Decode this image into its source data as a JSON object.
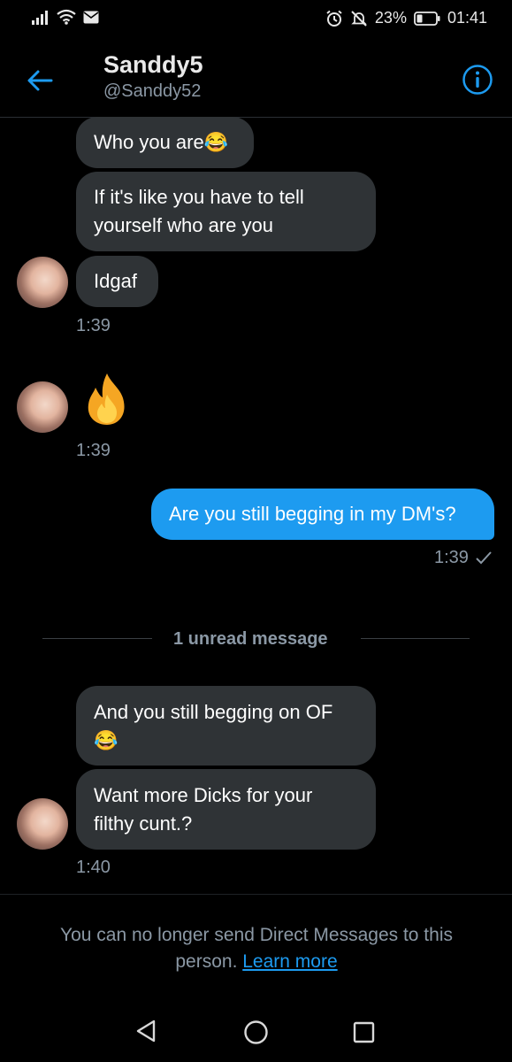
{
  "status_bar": {
    "battery": "23%",
    "time": "01:41"
  },
  "header": {
    "name": "Sanddy5",
    "handle": "@Sanddy52"
  },
  "messages": {
    "m1": "Who you are😂",
    "m2_line1": "If it's like you have to tell",
    "m2_line2": "yourself who are you",
    "m3": "Idgaf",
    "t1": "1:39",
    "m4_emoji": "🔥",
    "t2": "1:39",
    "m5": "Are you still begging in my DM's?",
    "t3": "1:39",
    "m6_line1": "And you still begging on OF",
    "m6_line2": "😂",
    "m7_line1": "Want more Dicks for your",
    "m7_line2": "filthy cunt.?",
    "t4": "1:40"
  },
  "unread_divider": "1 unread message",
  "footer": {
    "notice_line1": "You can no longer send Direct Messages to this",
    "notice_line2": "person.",
    "learn_more": "Learn more"
  },
  "colors": {
    "accent": "#1d9bf0",
    "bubble_in": "#2f3336",
    "background": "#000000"
  }
}
